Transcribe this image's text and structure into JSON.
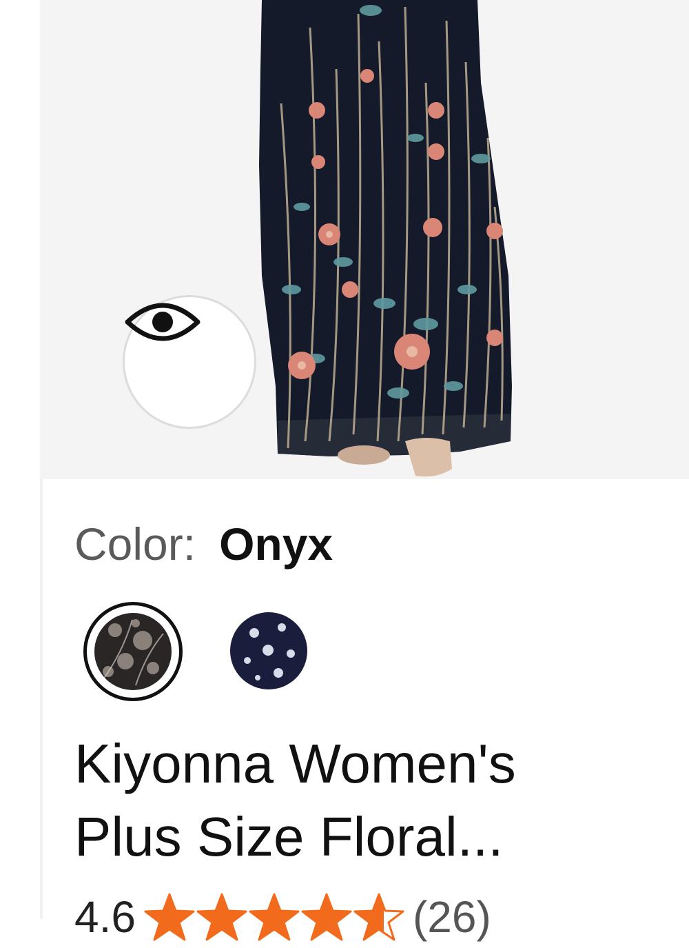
{
  "product": {
    "image_alt": "Kiyonna floral embroidered maxi dress in Onyx",
    "quick_view_icon": "eye-icon",
    "color_label": "Color:",
    "color_value": "Onyx",
    "swatches": [
      {
        "name": "Onyx",
        "selected": true
      },
      {
        "name": "Navy",
        "selected": false
      }
    ],
    "title_line1": "Kiyonna Women's",
    "title_line2": "Plus Size Floral...",
    "rating": "4.6",
    "rating_value": 4.6,
    "rating_max": 5,
    "review_count": "(26)"
  },
  "colors": {
    "star": "#f26b1d",
    "dress": "#141a2a",
    "background": "#f4f4f4"
  }
}
